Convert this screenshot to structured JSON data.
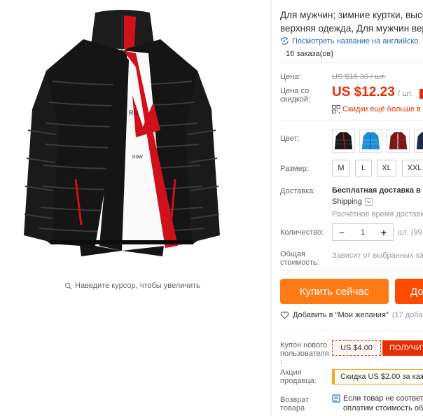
{
  "image": {
    "zoom_hint": "Наведите курсор, чтобы увеличить"
  },
  "product": {
    "title_line1": "Для мужчин; зимние куртки, высо",
    "title_line2": "верхняя одежда, Для мужчин вер",
    "translate_link": "Посмотреть название на английско",
    "orders": "16 заказа(ов)"
  },
  "price": {
    "label": "Цена:",
    "old_value": "US $16.30 / шт.",
    "discount_label_line1": "Цена со",
    "discount_label_line2": "скидкой:",
    "value": "US $12.23",
    "unit": "/ шт.",
    "discount_text": "Скидки ещё больше в п"
  },
  "color": {
    "label": "Цвет:",
    "swatches": [
      {
        "name": "black",
        "hex": "#1a1a1a"
      },
      {
        "name": "blue",
        "hex": "#1e8ed8"
      },
      {
        "name": "dark-red",
        "hex": "#7a1518"
      },
      {
        "name": "navy",
        "hex": "#1f2a4a"
      }
    ]
  },
  "size": {
    "label": "Размер:",
    "options": [
      "M",
      "L",
      "XL",
      "XXL"
    ]
  },
  "shipping": {
    "label": "Доставка:",
    "title": "Бесплатная доставка в R",
    "method": "Shipping",
    "estimate": "Расчётное время доставки"
  },
  "quantity": {
    "label": "Количество:",
    "minus": "−",
    "value": "1",
    "plus": "+",
    "unit": "шт. (99"
  },
  "total": {
    "label_line1": "Общая",
    "label_line2": "стоимость:",
    "value": "Зависит от выбранных хар"
  },
  "actions": {
    "buy_now": "Купить сейчас",
    "add_to_cart": "До"
  },
  "wishlist": {
    "label": "Добавить в \"Мои желания\"",
    "count": "(17 доба"
  },
  "coupon": {
    "label_line1": "Купон нового",
    "label_line2": "пользователя",
    "label_line3": ":",
    "value": "US $4.00",
    "button": "ПОЛУЧИТ"
  },
  "promo": {
    "label_line1": "Акция",
    "label_line2": "продавца:",
    "text": "Скидка US $2.00 за кажд"
  },
  "returns": {
    "label_line1": "Возврат",
    "label_line2": "товара",
    "text_line1": "Если товар не соответс",
    "text_line2": "оплатим стоимость обр"
  },
  "colors": {
    "accent_red": "#e62e04",
    "buy_orange": "#ff7a14",
    "cart_orange": "#ff4a00",
    "link_blue": "#2a6ab8",
    "promo_yellow": "#f5a623"
  }
}
